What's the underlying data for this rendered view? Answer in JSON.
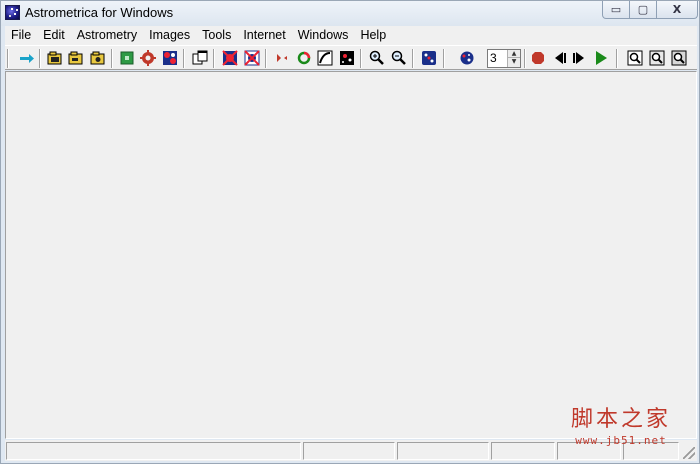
{
  "window": {
    "title": "Astrometrica for Windows",
    "caption_buttons": {
      "minimize": "▭",
      "maximize": "▢",
      "close": "X"
    }
  },
  "menu": {
    "items": [
      "File",
      "Edit",
      "Astrometry",
      "Images",
      "Tools",
      "Internet",
      "Windows",
      "Help"
    ]
  },
  "toolbar": {
    "spin_value": "3",
    "icons": [
      "connect-icon",
      "open-folder-icon",
      "open-folder-icon",
      "open-folder-icon",
      "green-square-icon",
      "gear-icon",
      "blob-icon",
      "window-icon",
      "cross-blob-icon",
      "cross-blob-icon",
      "arrows-icon",
      "circle-icon",
      "curve-icon",
      "black-image-icon",
      "zoom-in-icon",
      "zoom-out-icon",
      "dice-icon",
      "dice-icon",
      "record-icon",
      "previous-icon",
      "next-icon",
      "play-icon",
      "zoom-window-icon",
      "zoom-window-icon",
      "zoom-window-icon"
    ]
  },
  "statusbar": {
    "panels": [
      "",
      "",
      "",
      "",
      "",
      ""
    ]
  },
  "watermark": {
    "chinese": "脚本之家",
    "url": "www.jb51.net"
  },
  "colors": {
    "window_bg": "#f0f0f0",
    "frame": "#dfe8f2",
    "watermark": "#c0392b",
    "record": "#c0392b",
    "play": "#1a8a1a"
  }
}
